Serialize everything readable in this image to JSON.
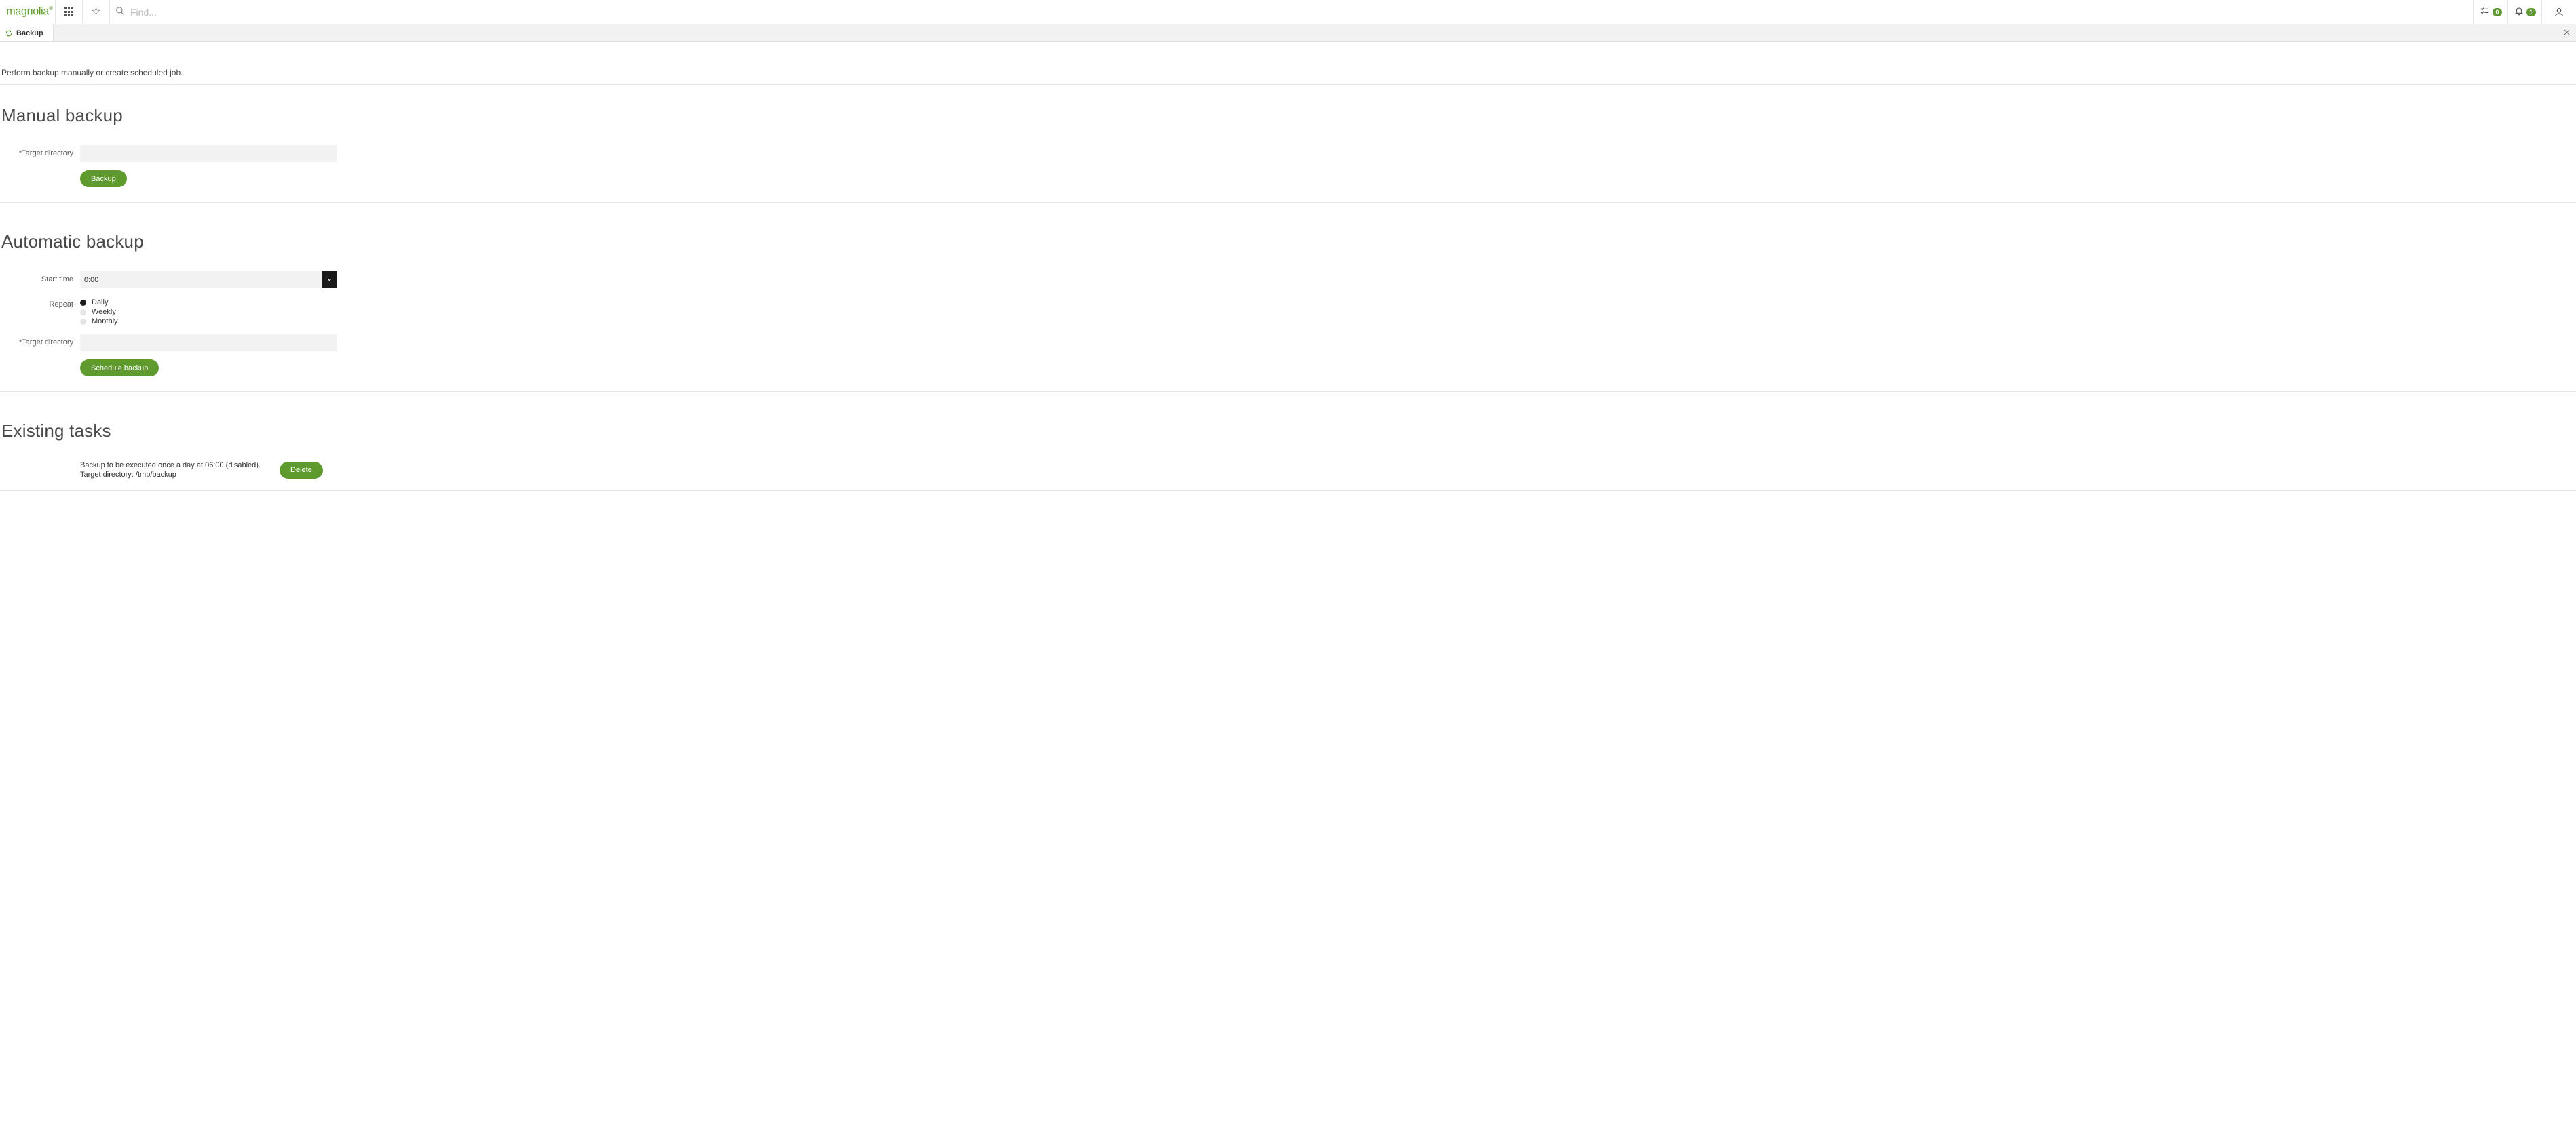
{
  "header": {
    "logo_text": "magnolia",
    "logo_reg": "®",
    "search_placeholder": "Find...",
    "tasks_badge": "0",
    "notifications_badge": "1"
  },
  "apptab": {
    "label": "Backup"
  },
  "intro": "Perform backup manually or create scheduled job.",
  "manual": {
    "heading": "Manual backup",
    "target_label": "*Target directory",
    "target_value": "",
    "button_label": "Backup"
  },
  "automatic": {
    "heading": "Automatic backup",
    "starttime_label": "Start time",
    "starttime_value": "0:00",
    "repeat_label": "Repeat",
    "repeat_options": [
      "Daily",
      "Weekly",
      "Monthly"
    ],
    "repeat_selected_index": 0,
    "target_label": "*Target directory",
    "target_value": "",
    "button_label": "Schedule backup"
  },
  "existing": {
    "heading": "Existing tasks",
    "task_line1": "Backup to be executed once a day at 06:00 (disabled).",
    "task_line2": "Target directory: /tmp/backup",
    "delete_label": "Delete"
  }
}
